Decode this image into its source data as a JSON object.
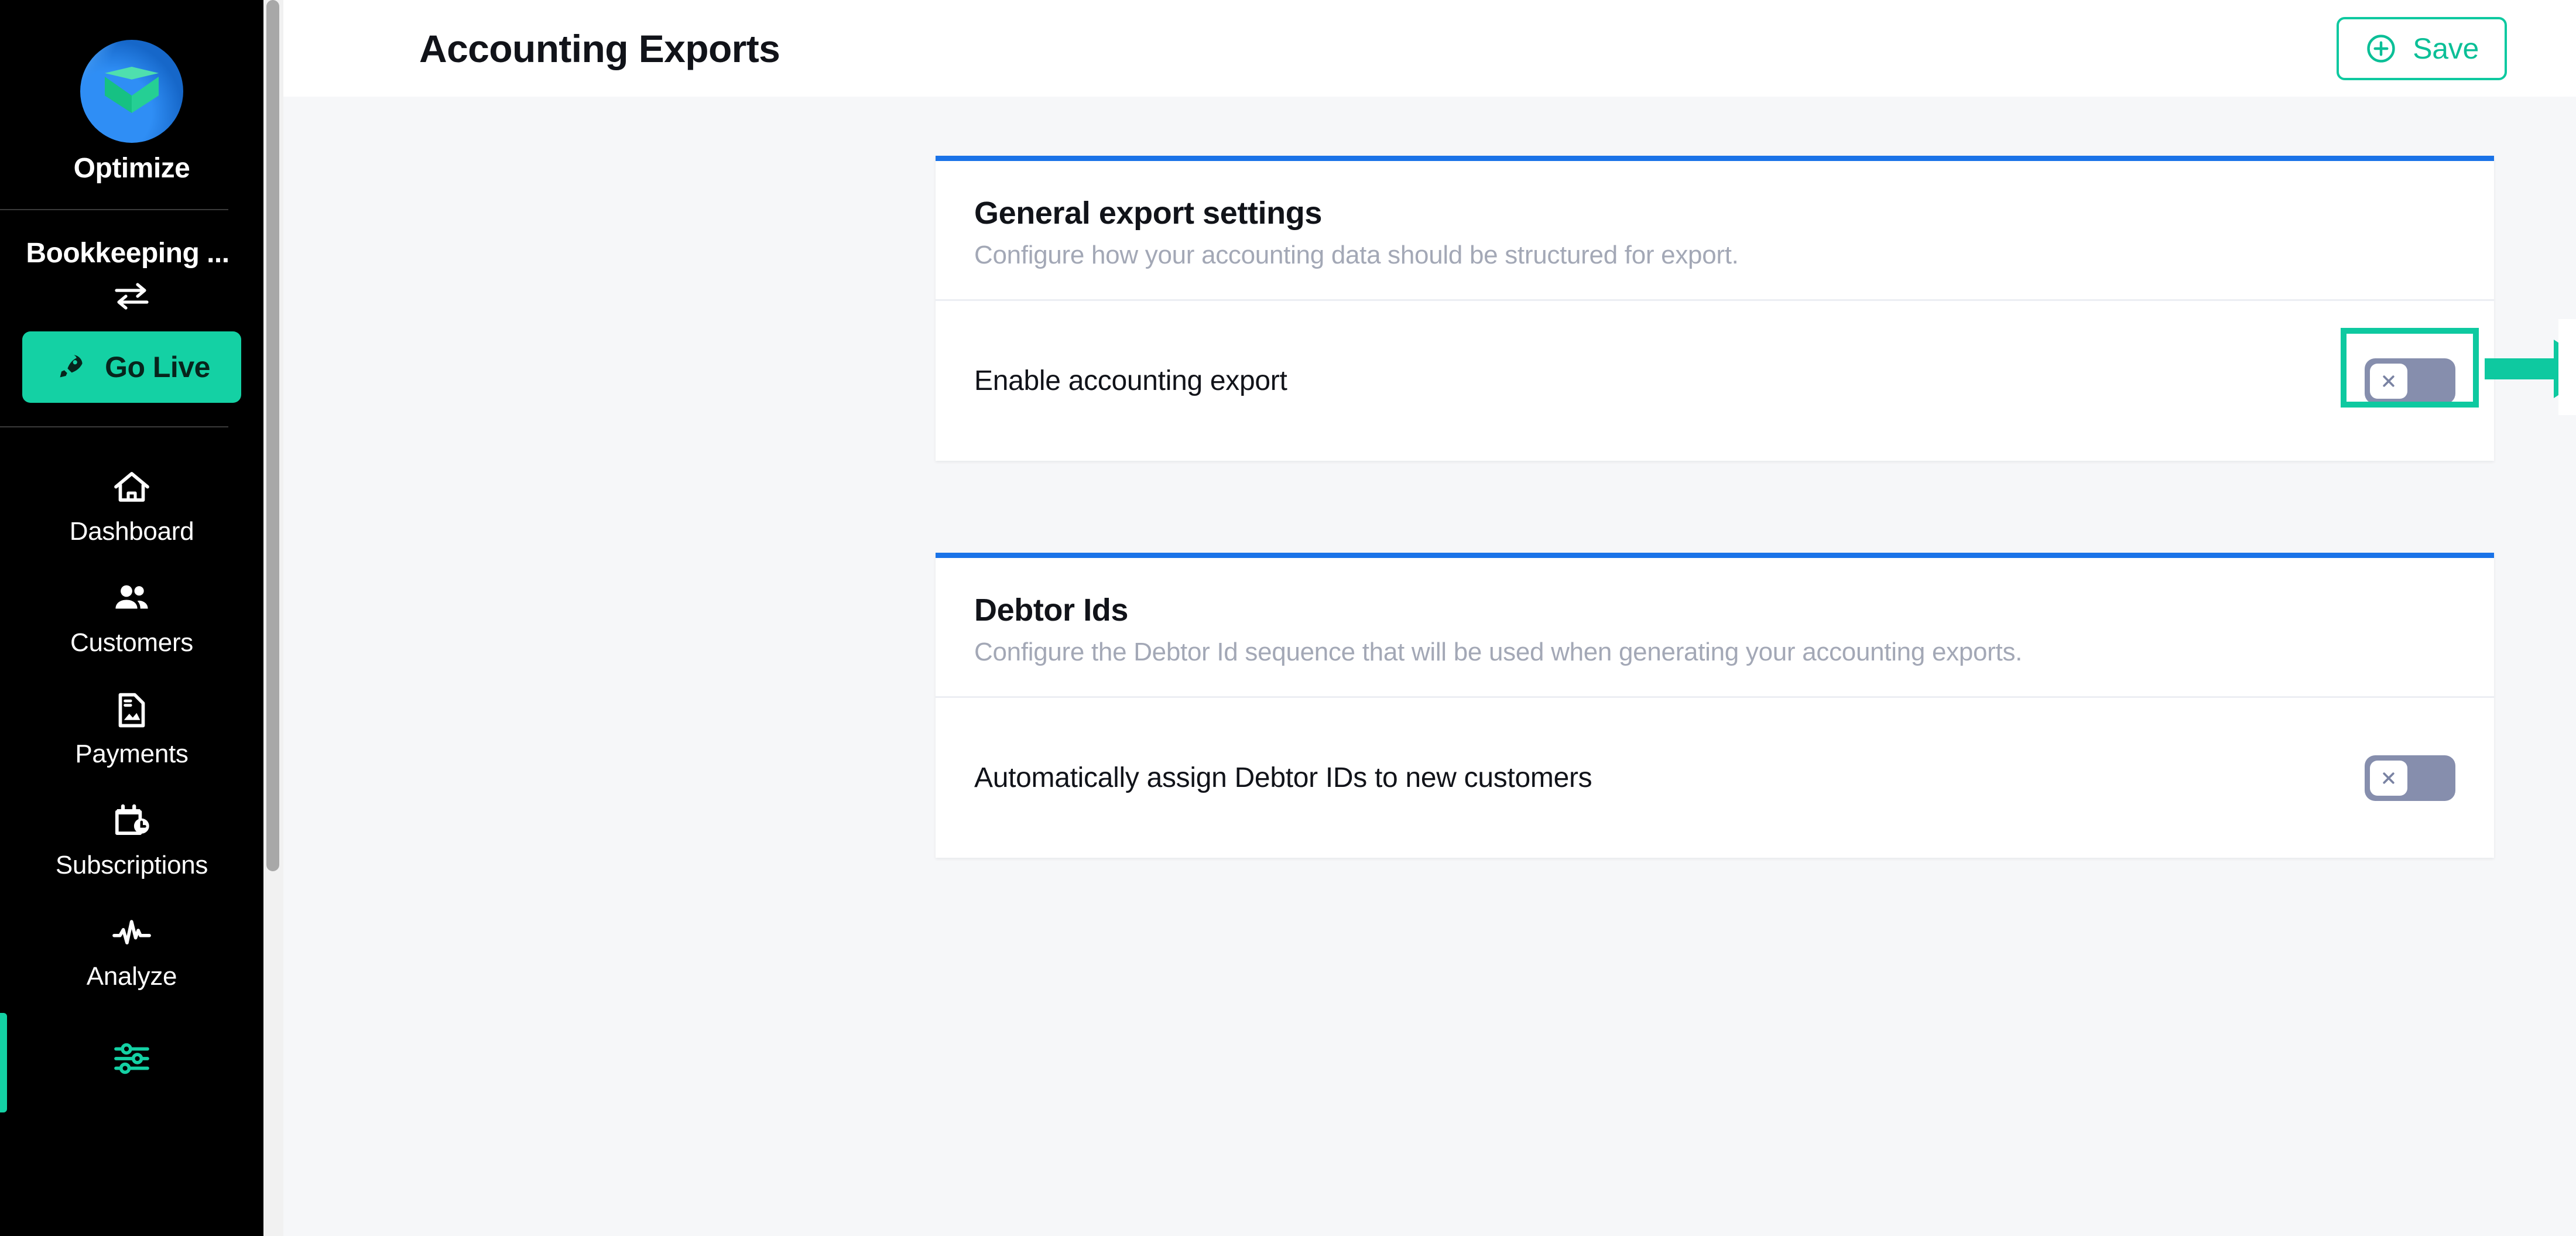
{
  "sidebar": {
    "brand": {
      "name": "Optimize",
      "logo_icon": "optimize-cube-logo"
    },
    "environment": {
      "name": "Bookkeeping ...",
      "swap_icon": "swap-arrows-icon"
    },
    "go_live": {
      "label": "Go Live",
      "icon": "rocket-icon",
      "color": "#14d1a4"
    },
    "items": [
      {
        "label": "Dashboard",
        "icon": "home-icon",
        "active": false
      },
      {
        "label": "Customers",
        "icon": "users-icon",
        "active": false
      },
      {
        "label": "Payments",
        "icon": "document-icon",
        "active": false
      },
      {
        "label": "Subscriptions",
        "icon": "calendar-clock-icon",
        "active": false
      },
      {
        "label": "Analyze",
        "icon": "pulse-icon",
        "active": false
      },
      {
        "label": "",
        "icon": "settings-sliders-icon",
        "active": true
      }
    ]
  },
  "header": {
    "title": "Accounting Exports",
    "save_label": "Save",
    "save_icon": "plus-circle-icon",
    "accent": "#0ec9a0"
  },
  "cards": [
    {
      "id": "general",
      "title": "General export settings",
      "subtitle": "Configure how your accounting data should be structured for export.",
      "accent": "#1a73e8",
      "row": {
        "label": "Enable accounting export",
        "toggle_state": "off",
        "toggle_icon": "x-icon"
      }
    },
    {
      "id": "debtor",
      "title": "Debtor Ids",
      "subtitle": "Configure the Debtor Id sequence that will be used when generating your accounting exports.",
      "accent": "#1a73e8",
      "row": {
        "label": "Automatically assign Debtor IDs to new customers",
        "toggle_state": "off",
        "toggle_icon": "x-icon"
      }
    }
  ],
  "annotation": {
    "highlight_color": "#0ec9a0",
    "arrow_icon": "right-arrow-annotation",
    "result_toggle_state": "on",
    "result_toggle_icon": "check-icon"
  }
}
